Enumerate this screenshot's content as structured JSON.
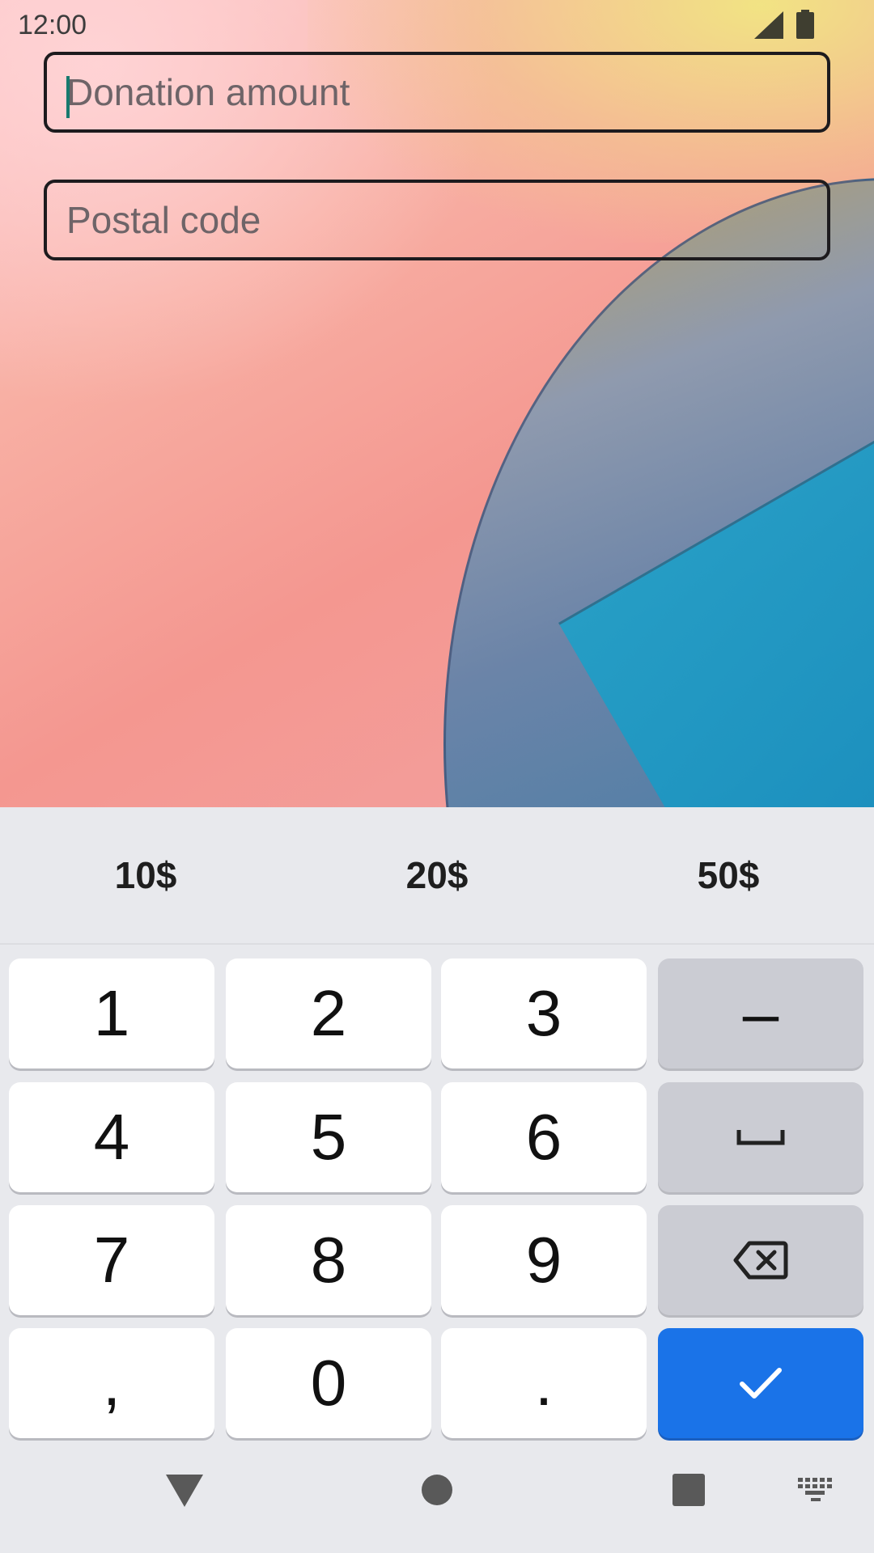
{
  "status_bar": {
    "time": "12:00"
  },
  "form": {
    "donation_placeholder": "Donation amount",
    "donation_value": "",
    "postal_placeholder": "Postal code",
    "postal_value": ""
  },
  "suggestions": [
    "10$",
    "20$",
    "50$"
  ],
  "keys": {
    "k1": "1",
    "k2": "2",
    "k3": "3",
    "minus": "–",
    "k4": "4",
    "k5": "5",
    "k6": "6",
    "k7": "7",
    "k8": "8",
    "k9": "9",
    "comma": ",",
    "k0": "0",
    "period": "."
  },
  "icons": {
    "space_key": "space-bar-icon",
    "delete_key": "backspace-icon",
    "enter_key": "check-icon",
    "nav_back": "triangle-down-icon",
    "nav_home": "circle-icon",
    "nav_recents": "square-icon",
    "nav_keyboard": "keyboard-icon"
  },
  "colors": {
    "enter_key": "#1a73e8",
    "caret": "#177a6e",
    "field_border": "#1d1b1e"
  }
}
